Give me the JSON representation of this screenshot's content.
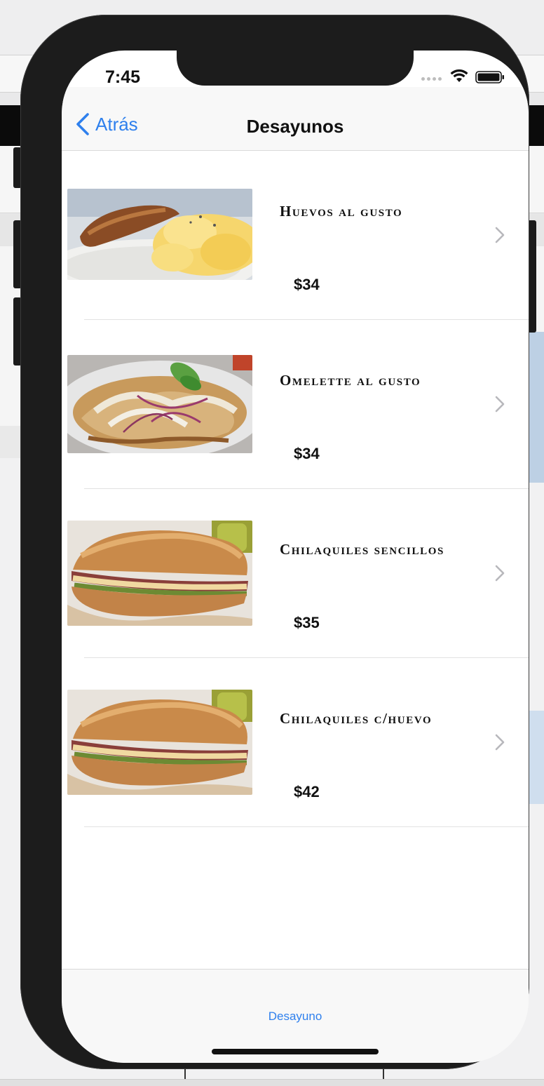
{
  "status_bar": {
    "time": "7:45"
  },
  "nav": {
    "back_label": "Atrás",
    "title": "Desayunos"
  },
  "items": [
    {
      "name": "Huevos al gusto",
      "price": "$34",
      "image": "scrambled-eggs"
    },
    {
      "name": "Omelette al gusto",
      "price": "$34",
      "image": "chilaquiles-plate"
    },
    {
      "name": "Chilaquiles sencillos",
      "price": "$35",
      "image": "torta-sandwich"
    },
    {
      "name": "Chilaquiles c/huevo",
      "price": "$42",
      "image": "torta-sandwich"
    }
  ],
  "tab_bar": {
    "tabs": [
      {
        "label": "Desayuno"
      }
    ]
  },
  "colors": {
    "accent": "#2f80ed",
    "text": "#111111",
    "separator": "#e2e2e2"
  }
}
